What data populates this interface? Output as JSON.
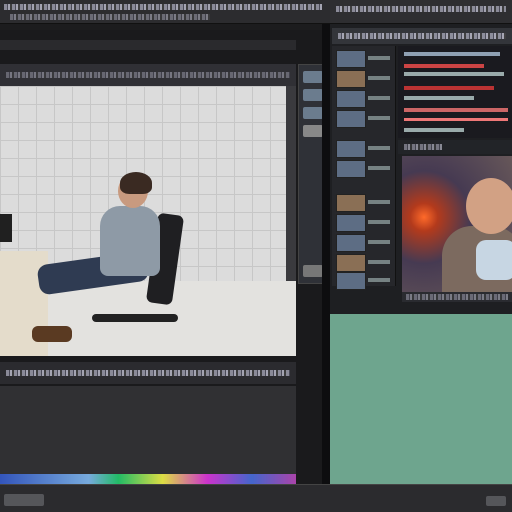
{
  "window": {
    "title_left": "",
    "title_right": ""
  },
  "viewer": {
    "caption": ""
  },
  "tool_buttons": [
    {
      "icon": "tool-icon"
    },
    {
      "icon": "tool-icon"
    },
    {
      "icon": "tool-icon"
    },
    {
      "icon": "tool-icon"
    },
    {
      "icon": "tool-icon"
    }
  ],
  "right_panel": {
    "thumbnails": [
      {
        "kind": "image"
      },
      {
        "kind": "image"
      },
      {
        "kind": "image"
      },
      {
        "kind": "image"
      },
      {
        "kind": "image"
      },
      {
        "kind": "image"
      },
      {
        "kind": "image"
      },
      {
        "kind": "image"
      },
      {
        "kind": "image"
      },
      {
        "kind": "image"
      },
      {
        "kind": "image"
      }
    ],
    "accent_colors": [
      "#c44",
      "#d55",
      "#b33",
      "#c66",
      "#e77"
    ]
  },
  "colors": {
    "background": "#1c1c1e",
    "teal_canvas": "#6ea58e",
    "wall": "#dcdcdc"
  }
}
